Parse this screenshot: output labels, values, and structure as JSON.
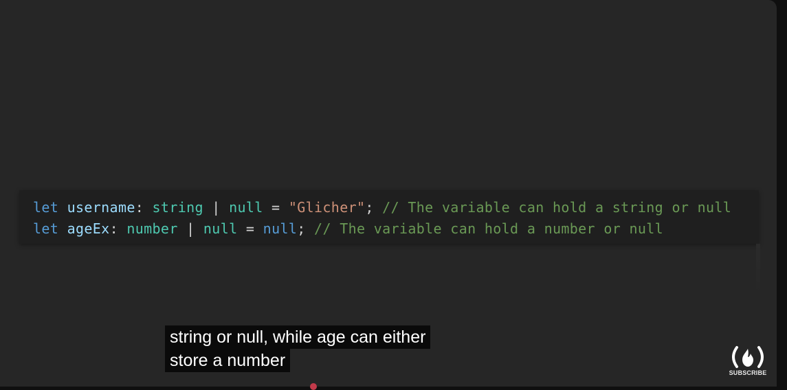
{
  "code": {
    "line1": {
      "kw": "let",
      "name": "username",
      "colon": ": ",
      "type1": "string",
      "pipe": " | ",
      "type2": "null",
      "eq": " = ",
      "value": "\"Glicher\"",
      "semi": "; ",
      "comment": "// The variable can hold a string or null"
    },
    "line2": {
      "kw": "let",
      "name": "ageEx",
      "colon": ": ",
      "type1": "number",
      "pipe": " | ",
      "type2": "null",
      "eq": " = ",
      "value": "null",
      "semi": "; ",
      "comment": "// The variable can hold a number or null"
    }
  },
  "caption": {
    "line1": "string or null, while age can either",
    "line2": "store a number"
  },
  "channel_badge": {
    "icon": "freecodecamp-fire-icon",
    "label": "SUBSCRIBE"
  },
  "colors": {
    "background": "#262626",
    "keyword": "#569cd6",
    "identifier": "#9cdcfe",
    "type": "#4ec9b0",
    "string": "#ce9178",
    "comment": "#6a9955",
    "progress": "#c23a4a"
  }
}
